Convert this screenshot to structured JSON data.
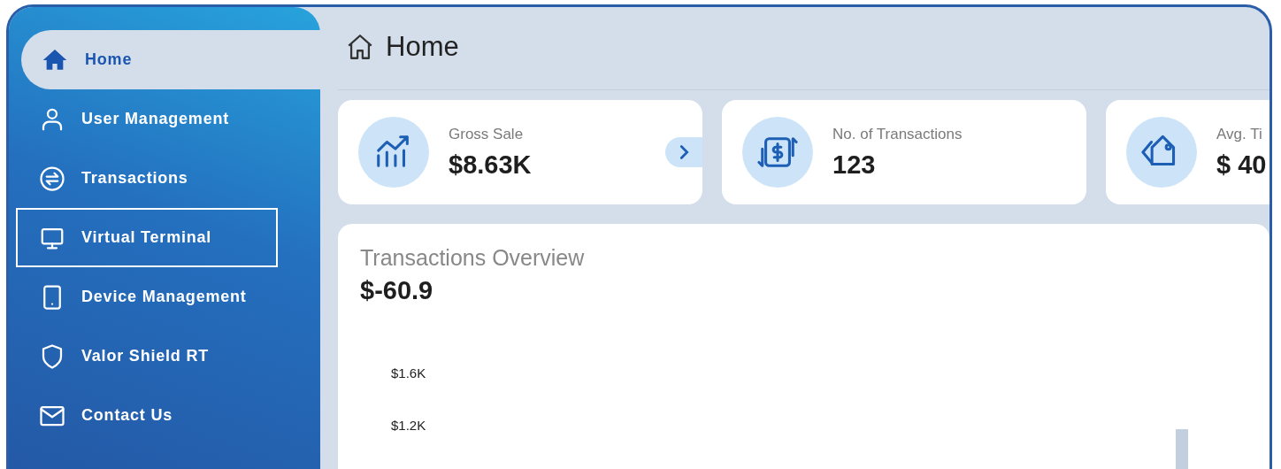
{
  "sidebar": {
    "items": [
      {
        "kind": "home",
        "label": "Home",
        "selected": true,
        "focused": false
      },
      {
        "kind": "user",
        "label": "User Management",
        "selected": false,
        "focused": false
      },
      {
        "kind": "transactions",
        "label": "Transactions",
        "selected": false,
        "focused": false
      },
      {
        "kind": "terminal",
        "label": "Virtual Terminal",
        "selected": false,
        "focused": true
      },
      {
        "kind": "device",
        "label": "Device Management",
        "selected": false,
        "focused": false
      },
      {
        "kind": "shield",
        "label": "Valor Shield RT",
        "selected": false,
        "focused": false
      },
      {
        "kind": "mail",
        "label": "Contact Us",
        "selected": false,
        "focused": false
      }
    ]
  },
  "header": {
    "title": "Home"
  },
  "stat_cards": [
    {
      "kind": "sales",
      "label": "Gross Sale",
      "value": "$8.63K"
    },
    {
      "kind": "count",
      "label": "No. of Transactions",
      "value": "123"
    },
    {
      "kind": "ticket",
      "label": "Avg. Ti",
      "value": "$ 40"
    }
  ],
  "cards_next_button": true,
  "overview": {
    "title": "Transactions Overview",
    "total": "$-60.9",
    "y_labels": [
      "$1.6K",
      "$1.2K"
    ]
  }
}
